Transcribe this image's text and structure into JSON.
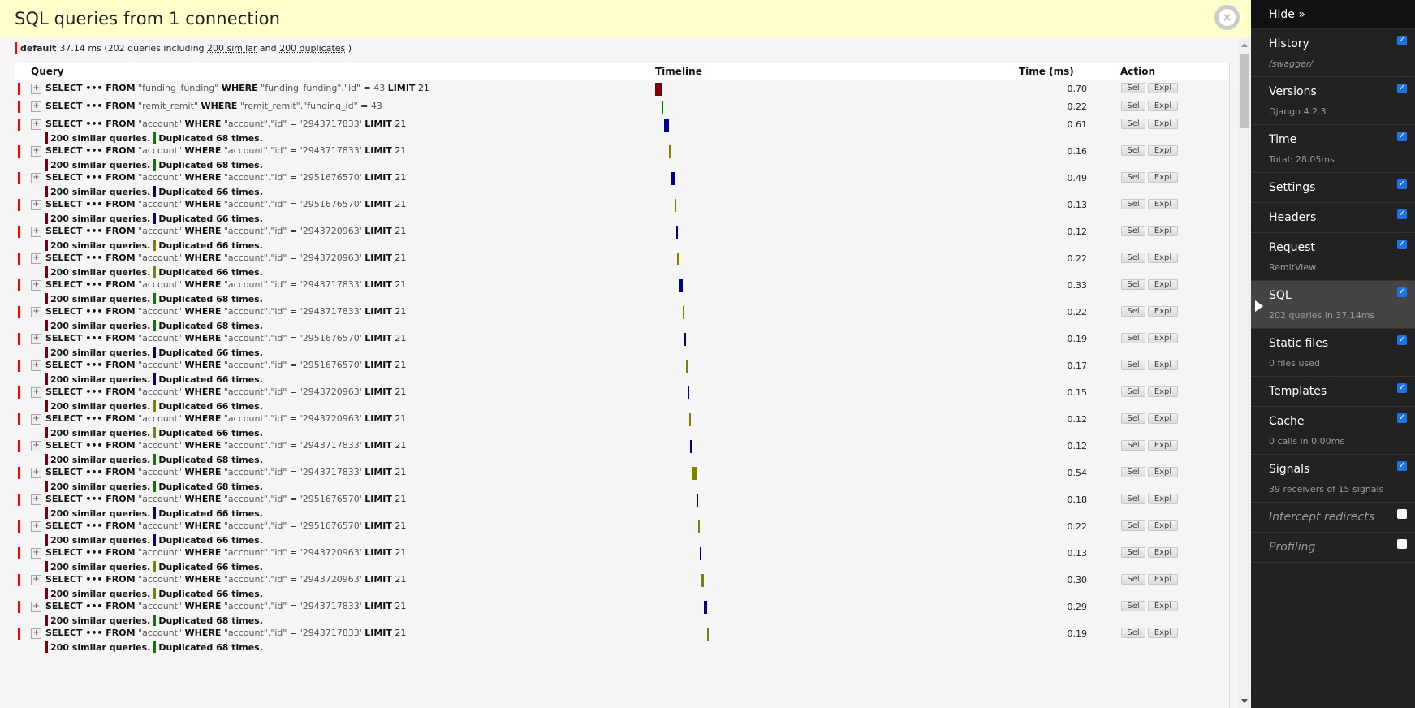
{
  "panel": {
    "title": "SQL queries from 1 connection",
    "close_icon": "×"
  },
  "summary": {
    "alias": "default",
    "time": "37.14 ms",
    "prefix": "(202 queries including",
    "similar_link": "200 similar",
    "and": "and",
    "duplicates_link": "200 duplicates",
    "suffix": ")"
  },
  "table": {
    "headers": {
      "query": "Query",
      "timeline": "Timeline",
      "time": "Time (ms)",
      "action": "Action"
    },
    "buttons": {
      "sel": "Sel",
      "expl": "Expl"
    },
    "toggle_icon": "+",
    "colors": {
      "flag": "#ff0000",
      "similar": "#800000",
      "dup_2943717833": "#008000",
      "dup_2951676570": "#000080",
      "dup_2943720963": "#808000"
    },
    "rows": [
      {
        "table": "\"funding_funding\"",
        "where_col": "\"funding_funding\".\"id\"",
        "value": "43",
        "limit": "21",
        "time": "0.70",
        "similar": "",
        "duplicated": "",
        "dup_color": "",
        "tl_color": "#800000",
        "tl_start": 0.0,
        "tl_frac": 0.019
      },
      {
        "table": "\"remit_remit\"",
        "where_col": "\"remit_remit\".\"funding_id\"",
        "value": "43",
        "limit": "",
        "time": "0.22",
        "similar": "",
        "duplicated": "",
        "dup_color": "",
        "tl_color": "#008000",
        "tl_start": 0.019,
        "tl_frac": 0.006
      },
      {
        "table": "\"account\"",
        "where_col": "\"account\".\"id\"",
        "value": "'2943717833'",
        "limit": "21",
        "time": "0.61",
        "similar": "200 similar queries.",
        "duplicated": "Duplicated 68 times.",
        "dup_color": "#008000",
        "tl_color": "#000080",
        "tl_start": 0.025,
        "tl_frac": 0.016
      },
      {
        "table": "\"account\"",
        "where_col": "\"account\".\"id\"",
        "value": "'2943717833'",
        "limit": "21",
        "time": "0.16",
        "similar": "200 similar queries.",
        "duplicated": "Duplicated 68 times.",
        "dup_color": "#008000",
        "tl_color": "#808000",
        "tl_start": 0.041,
        "tl_frac": 0.004
      },
      {
        "table": "\"account\"",
        "where_col": "\"account\".\"id\"",
        "value": "'2951676570'",
        "limit": "21",
        "time": "0.49",
        "similar": "200 similar queries.",
        "duplicated": "Duplicated 66 times.",
        "dup_color": "#000080",
        "tl_color": "#000080",
        "tl_start": 0.045,
        "tl_frac": 0.013
      },
      {
        "table": "\"account\"",
        "where_col": "\"account\".\"id\"",
        "value": "'2951676570'",
        "limit": "21",
        "time": "0.13",
        "similar": "200 similar queries.",
        "duplicated": "Duplicated 66 times.",
        "dup_color": "#000080",
        "tl_color": "#808000",
        "tl_start": 0.058,
        "tl_frac": 0.004
      },
      {
        "table": "\"account\"",
        "where_col": "\"account\".\"id\"",
        "value": "'2943720963'",
        "limit": "21",
        "time": "0.12",
        "similar": "200 similar queries.",
        "duplicated": "Duplicated 66 times.",
        "dup_color": "#808000",
        "tl_color": "#000080",
        "tl_start": 0.062,
        "tl_frac": 0.003
      },
      {
        "table": "\"account\"",
        "where_col": "\"account\".\"id\"",
        "value": "'2943720963'",
        "limit": "21",
        "time": "0.22",
        "similar": "200 similar queries.",
        "duplicated": "Duplicated 66 times.",
        "dup_color": "#808000",
        "tl_color": "#808000",
        "tl_start": 0.065,
        "tl_frac": 0.006
      },
      {
        "table": "\"account\"",
        "where_col": "\"account\".\"id\"",
        "value": "'2943717833'",
        "limit": "21",
        "time": "0.33",
        "similar": "200 similar queries.",
        "duplicated": "Duplicated 68 times.",
        "dup_color": "#008000",
        "tl_color": "#000080",
        "tl_start": 0.071,
        "tl_frac": 0.009
      },
      {
        "table": "\"account\"",
        "where_col": "\"account\".\"id\"",
        "value": "'2943717833'",
        "limit": "21",
        "time": "0.22",
        "similar": "200 similar queries.",
        "duplicated": "Duplicated 68 times.",
        "dup_color": "#008000",
        "tl_color": "#808000",
        "tl_start": 0.08,
        "tl_frac": 0.006
      },
      {
        "table": "\"account\"",
        "where_col": "\"account\".\"id\"",
        "value": "'2951676570'",
        "limit": "21",
        "time": "0.19",
        "similar": "200 similar queries.",
        "duplicated": "Duplicated 66 times.",
        "dup_color": "#000080",
        "tl_color": "#000080",
        "tl_start": 0.086,
        "tl_frac": 0.005
      },
      {
        "table": "\"account\"",
        "where_col": "\"account\".\"id\"",
        "value": "'2951676570'",
        "limit": "21",
        "time": "0.17",
        "similar": "200 similar queries.",
        "duplicated": "Duplicated 66 times.",
        "dup_color": "#000080",
        "tl_color": "#808000",
        "tl_start": 0.091,
        "tl_frac": 0.005
      },
      {
        "table": "\"account\"",
        "where_col": "\"account\".\"id\"",
        "value": "'2943720963'",
        "limit": "21",
        "time": "0.15",
        "similar": "200 similar queries.",
        "duplicated": "Duplicated 66 times.",
        "dup_color": "#808000",
        "tl_color": "#000080",
        "tl_start": 0.096,
        "tl_frac": 0.004
      },
      {
        "table": "\"account\"",
        "where_col": "\"account\".\"id\"",
        "value": "'2943720963'",
        "limit": "21",
        "time": "0.12",
        "similar": "200 similar queries.",
        "duplicated": "Duplicated 66 times.",
        "dup_color": "#808000",
        "tl_color": "#808000",
        "tl_start": 0.1,
        "tl_frac": 0.003
      },
      {
        "table": "\"account\"",
        "where_col": "\"account\".\"id\"",
        "value": "'2943717833'",
        "limit": "21",
        "time": "0.12",
        "similar": "200 similar queries.",
        "duplicated": "Duplicated 68 times.",
        "dup_color": "#008000",
        "tl_color": "#000080",
        "tl_start": 0.103,
        "tl_frac": 0.003
      },
      {
        "table": "\"account\"",
        "where_col": "\"account\".\"id\"",
        "value": "'2943717833'",
        "limit": "21",
        "time": "0.54",
        "similar": "200 similar queries.",
        "duplicated": "Duplicated 68 times.",
        "dup_color": "#008000",
        "tl_color": "#808000",
        "tl_start": 0.106,
        "tl_frac": 0.015
      },
      {
        "table": "\"account\"",
        "where_col": "\"account\".\"id\"",
        "value": "'2951676570'",
        "limit": "21",
        "time": "0.18",
        "similar": "200 similar queries.",
        "duplicated": "Duplicated 66 times.",
        "dup_color": "#000080",
        "tl_color": "#000080",
        "tl_start": 0.121,
        "tl_frac": 0.005
      },
      {
        "table": "\"account\"",
        "where_col": "\"account\".\"id\"",
        "value": "'2951676570'",
        "limit": "21",
        "time": "0.22",
        "similar": "200 similar queries.",
        "duplicated": "Duplicated 66 times.",
        "dup_color": "#000080",
        "tl_color": "#808000",
        "tl_start": 0.126,
        "tl_frac": 0.006
      },
      {
        "table": "\"account\"",
        "where_col": "\"account\".\"id\"",
        "value": "'2943720963'",
        "limit": "21",
        "time": "0.13",
        "similar": "200 similar queries.",
        "duplicated": "Duplicated 66 times.",
        "dup_color": "#808000",
        "tl_color": "#000080",
        "tl_start": 0.132,
        "tl_frac": 0.004
      },
      {
        "table": "\"account\"",
        "where_col": "\"account\".\"id\"",
        "value": "'2943720963'",
        "limit": "21",
        "time": "0.30",
        "similar": "200 similar queries.",
        "duplicated": "Duplicated 66 times.",
        "dup_color": "#808000",
        "tl_color": "#808000",
        "tl_start": 0.136,
        "tl_frac": 0.008
      },
      {
        "table": "\"account\"",
        "where_col": "\"account\".\"id\"",
        "value": "'2943717833'",
        "limit": "21",
        "time": "0.29",
        "similar": "200 similar queries.",
        "duplicated": "Duplicated 68 times.",
        "dup_color": "#008000",
        "tl_color": "#000080",
        "tl_start": 0.144,
        "tl_frac": 0.008
      },
      {
        "table": "\"account\"",
        "where_col": "\"account\".\"id\"",
        "value": "'2943717833'",
        "limit": "21",
        "time": "0.19",
        "similar": "200 similar queries.",
        "duplicated": "Duplicated 68 times.",
        "dup_color": "#008000",
        "tl_color": "#808000",
        "tl_start": 0.152,
        "tl_frac": 0.005
      }
    ]
  },
  "toolbar": {
    "hide_label": "Hide »",
    "items": [
      {
        "label": "History",
        "sub": "/swagger/",
        "checked": true,
        "sub_italic": true
      },
      {
        "label": "Versions",
        "sub": "Django 4.2.3",
        "checked": true
      },
      {
        "label": "Time",
        "sub": "Total: 28.05ms",
        "checked": true
      },
      {
        "label": "Settings",
        "sub": "",
        "checked": true
      },
      {
        "label": "Headers",
        "sub": "",
        "checked": true
      },
      {
        "label": "Request",
        "sub": "RemitView",
        "checked": true
      },
      {
        "label": "SQL",
        "sub": "202 queries in 37.14ms",
        "checked": true,
        "active": true
      },
      {
        "label": "Static files",
        "sub": "0 files used",
        "checked": true
      },
      {
        "label": "Templates",
        "sub": "",
        "checked": true
      },
      {
        "label": "Cache",
        "sub": "0 calls in 0.00ms",
        "checked": true
      },
      {
        "label": "Signals",
        "sub": "39 receivers of 15 signals",
        "checked": true
      },
      {
        "label": "Intercept redirects",
        "sub": "",
        "checked": false,
        "disabled": true
      },
      {
        "label": "Profiling",
        "sub": "",
        "checked": false,
        "disabled": true
      }
    ],
    "check_icon": "✓"
  }
}
